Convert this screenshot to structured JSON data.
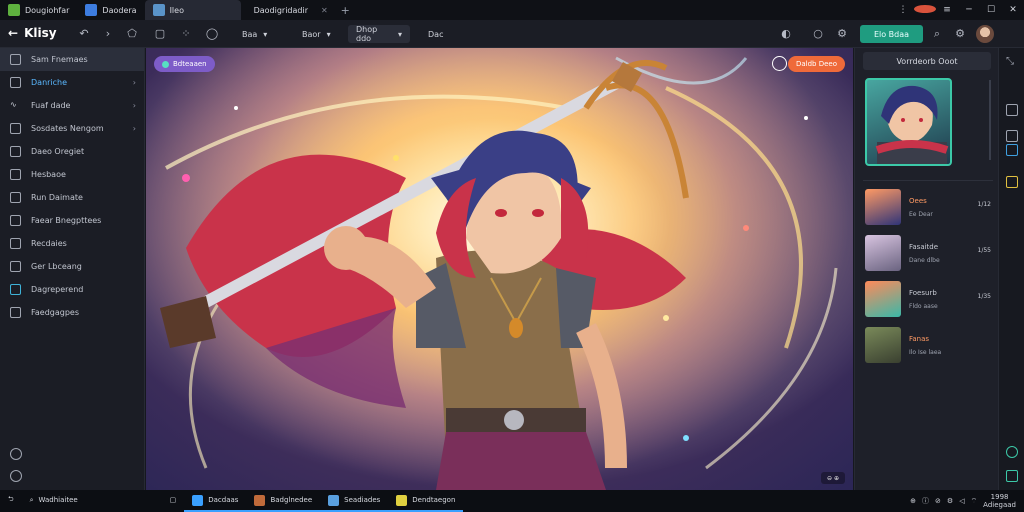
{
  "titlebar": {
    "tabs": [
      {
        "label": "Dougiohfar",
        "color": "#5fb13f"
      },
      {
        "label": "Daodera",
        "color": "#3d7de0"
      },
      {
        "label": "Ileo",
        "color": "#5a94c9",
        "active": true
      },
      {
        "label": "Daodigridadir",
        "color": "#e9a74b"
      }
    ]
  },
  "toolbar": {
    "app_name": "Klisy",
    "dropdowns": [
      {
        "label": "Baa"
      },
      {
        "label": "Baor"
      },
      {
        "label": "Dhop ddo"
      },
      {
        "label": "Dac"
      }
    ],
    "subscribe_label": "Elo Bdaa"
  },
  "sidebar": {
    "items": [
      {
        "label": "Sam Fnemaes"
      },
      {
        "label": "Danriche"
      },
      {
        "label": "Fuaf dade"
      },
      {
        "label": "Sosdates Nengom"
      },
      {
        "label": "Daeo Oregiet"
      },
      {
        "label": "Hesbaoe"
      },
      {
        "label": "Run Daimate"
      },
      {
        "label": "Faear Bnegpttees"
      },
      {
        "label": "Recdaies"
      },
      {
        "label": "Ger Lbceang"
      },
      {
        "label": "Dagreperend"
      },
      {
        "label": "Faedgagpes"
      }
    ]
  },
  "canvas": {
    "badge_label": "Bdteaaen",
    "tag_label": "Daldb Deeo"
  },
  "right_panel": {
    "title": "Vorrdeorb Ooot",
    "layers": [
      {
        "name": "Oees",
        "sub": "Ee Dear",
        "value": "1/12"
      },
      {
        "name": "Fasaitde",
        "sub": "Dane dlbe",
        "value": "1/55"
      },
      {
        "name": "Foesurb",
        "sub": "Fldo aase",
        "value": "1/35"
      },
      {
        "name": "Fanas",
        "sub": "Ilo Ise laea",
        "value": ""
      }
    ]
  },
  "taskbar": {
    "search_label": "Wadhiaitee",
    "tasks": [
      {
        "label": "Dacdaas"
      },
      {
        "label": "Badglnedee"
      },
      {
        "label": "Seadiades"
      },
      {
        "label": "Dendtaegon"
      }
    ],
    "clock_time": "1998",
    "clock_date": "Adiegaad"
  }
}
